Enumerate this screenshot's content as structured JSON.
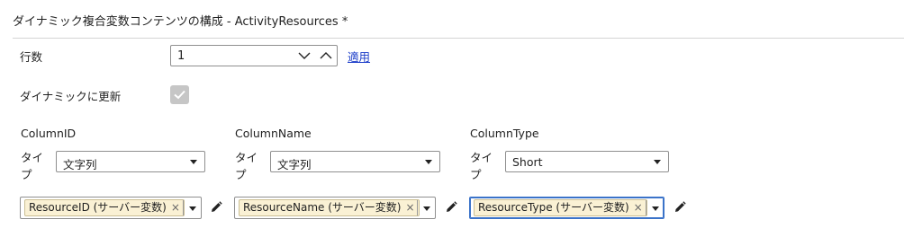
{
  "title": "ダイナミック複合変数コンテンツの構成 - ActivityResources *",
  "rows": {
    "label": "行数",
    "value": "1",
    "apply_label": "適用",
    "spin_down_icon": "chevron-down-icon",
    "spin_up_icon": "chevron-up-icon"
  },
  "dynamic_update": {
    "label": "ダイナミックに更新",
    "checked": true
  },
  "type_label_line1": "タイ",
  "type_label_line2": "プ",
  "columns": [
    {
      "header": "ColumnID",
      "type_value": "文字列",
      "variable": "ResourceID (サーバー変数)",
      "focused": false
    },
    {
      "header": "ColumnName",
      "type_value": "文字列",
      "variable": "ResourceName (サーバー変数)",
      "focused": false
    },
    {
      "header": "ColumnType",
      "type_value": "Short",
      "variable": "ResourceType (サーバー変数)",
      "focused": true
    }
  ],
  "chip_remove_glyph": "×",
  "colors": {
    "link": "#1a3cc8",
    "chip_bg": "#faf1d4",
    "focus_border": "#3b73c9",
    "checkbox_bg": "#c6c6c6"
  }
}
